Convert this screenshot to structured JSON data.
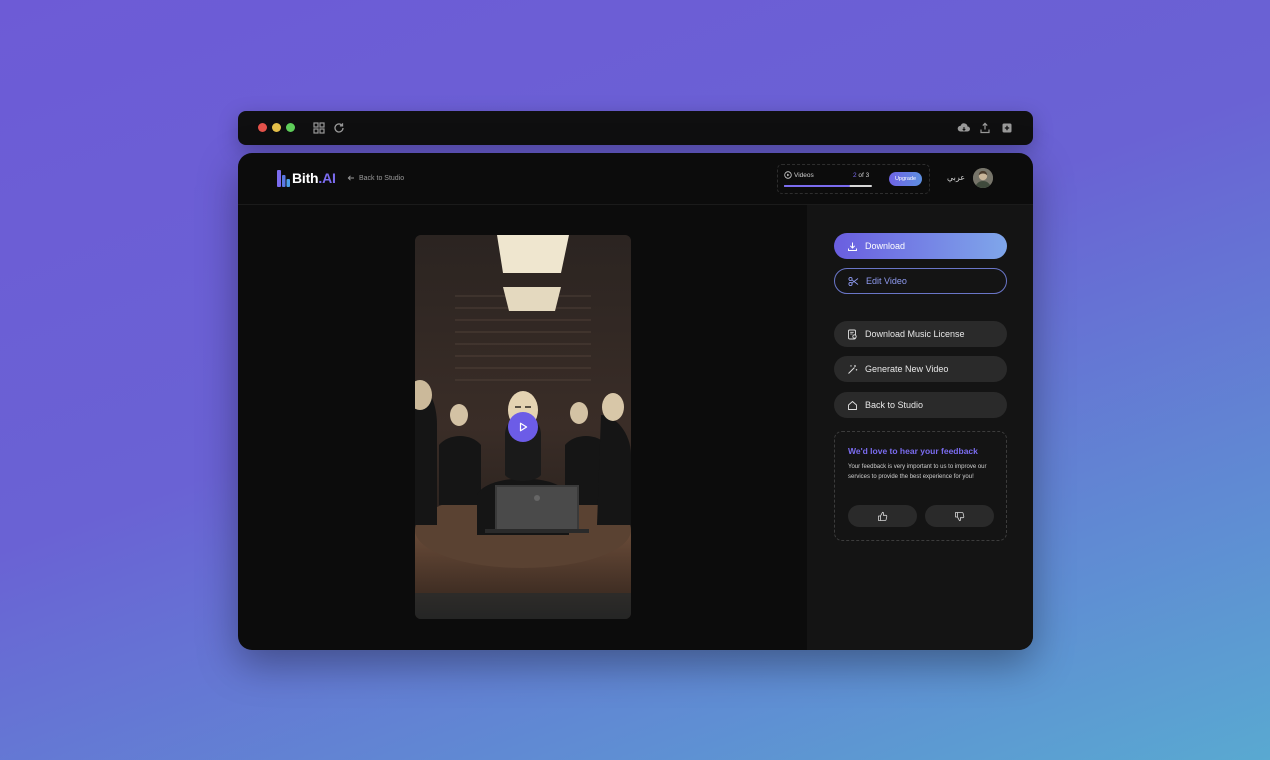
{
  "browser": {
    "traffic_lights": [
      "#e5534b",
      "#e6c14a",
      "#5fcf5a"
    ],
    "left_icons": [
      "grid-icon",
      "refresh-icon"
    ],
    "right_icons": [
      "cloud-download-icon",
      "share-upload-icon",
      "plus-square-icon"
    ]
  },
  "header": {
    "logo_text": "Bith",
    "logo_suffix": ".AI",
    "back_link": "Back to Studio",
    "usage": {
      "label": "Videos",
      "count_used": "2",
      "count_total": " of 3",
      "progress_fraction": 0.75,
      "upgrade": "Upgrade"
    },
    "language": "عربي"
  },
  "sidebar": {
    "download": "Download",
    "edit_video": "Edit Video",
    "download_license": "Download Music License",
    "generate_new": "Generate New Video",
    "back_to_studio": "Back to Studio"
  },
  "feedback": {
    "title": "We'd love to hear your feedback",
    "text": "Your feedback is very important to us to improve our services to provide the best experience for you!"
  },
  "colors": {
    "accent": "#7b6cf0",
    "primary_gradient_start": "#6a5ee0",
    "primary_gradient_end": "#7fa6ea",
    "app_background": "#0c0c0c",
    "sidebar_background": "#141414"
  }
}
